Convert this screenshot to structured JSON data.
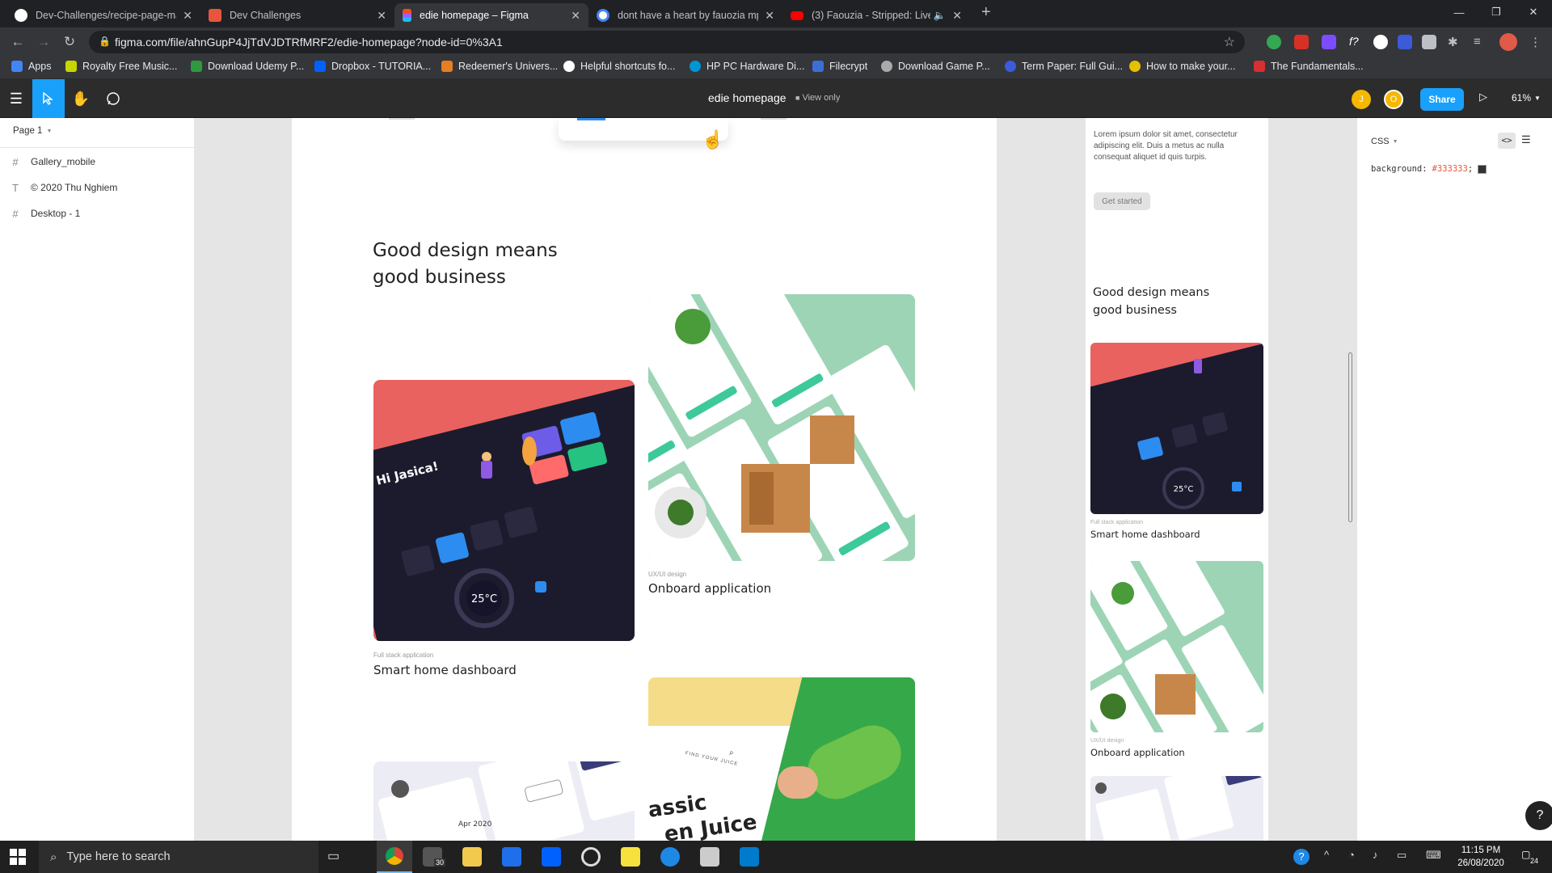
{
  "browser": {
    "tabs": [
      {
        "title": "Dev-Challenges/recipe-page-ma",
        "color": "#ffffff"
      },
      {
        "title": "Dev Challenges",
        "color": "#e8553d"
      },
      {
        "title": "edie homepage – Figma",
        "color": "#a259ff"
      },
      {
        "title": "dont have a heart by fauozia mp",
        "color": "#4285f4"
      },
      {
        "title": "(3) Faouzia - Stripped: Live In",
        "color": "#ff0000"
      }
    ],
    "new_tab": "+",
    "url": "figma.com/file/ahnGupP4JjTdVJDTRfMRF2/edie-homepage?node-id=0%3A1",
    "bookmarks": [
      {
        "label": "Apps",
        "color": "#4285f4"
      },
      {
        "label": "Royalty Free Music...",
        "color": "#c7d600"
      },
      {
        "label": "Download Udemy P...",
        "color": "#2e9a3e"
      },
      {
        "label": "Dropbox - TUTORIA...",
        "color": "#0061ff"
      },
      {
        "label": "Redeemer's Univers...",
        "color": "#e67e22"
      },
      {
        "label": "Helpful shortcuts fo...",
        "color": "#ffffff"
      },
      {
        "label": "HP PC Hardware Di...",
        "color": "#0096d6"
      },
      {
        "label": "Filecrypt",
        "color": "#3b6fd6"
      },
      {
        "label": "Download Game P...",
        "color": "#aaaaaa"
      },
      {
        "label": "Term Paper: Full Gui...",
        "color": "#3b5bdb"
      },
      {
        "label": "How to make your...",
        "color": "#e5c100"
      },
      {
        "label": "The Fundamentals...",
        "color": "#d63031"
      }
    ]
  },
  "figma": {
    "file_title": "edie homepage",
    "view_mode": "View only",
    "share_label": "Share",
    "zoom": "61%",
    "avatars": [
      "J",
      "O"
    ],
    "page_selector": "Page 1",
    "layers": [
      {
        "icon": "#",
        "name": "Gallery_mobile"
      },
      {
        "icon": "T",
        "name": "© 2020 Thu Nghiem"
      },
      {
        "icon": "#",
        "name": "Desktop - 1"
      }
    ],
    "inspect": {
      "tab": "CSS",
      "property": "background:",
      "value": "#333333",
      "semicolon": ";",
      "swatch": "#333333"
    }
  },
  "design": {
    "heading_line1": "Good design means",
    "heading_line2": "good business",
    "cards": [
      {
        "category": "Full stack application",
        "title": "Smart home dashboard"
      },
      {
        "category": "UX/UI design",
        "title": "Onboard application"
      }
    ],
    "juice_text_1": "assic",
    "juice_text_2": "en Juice",
    "juice_small": "FIND YOUR JUICE",
    "mobile": {
      "lorem": "Lorem ipsum dolor sit amet, consectetur adipiscing elit. Duis a metus ac nulla consequat aliquet id quis turpis.",
      "button": "Get started",
      "heading_line1": "Good design means",
      "heading_line2": "good business"
    }
  },
  "taskbar": {
    "search_placeholder": "Type here to search",
    "time": "11:15 PM",
    "date": "26/08/2020",
    "notification_count": "24",
    "mail_badge": "30"
  }
}
